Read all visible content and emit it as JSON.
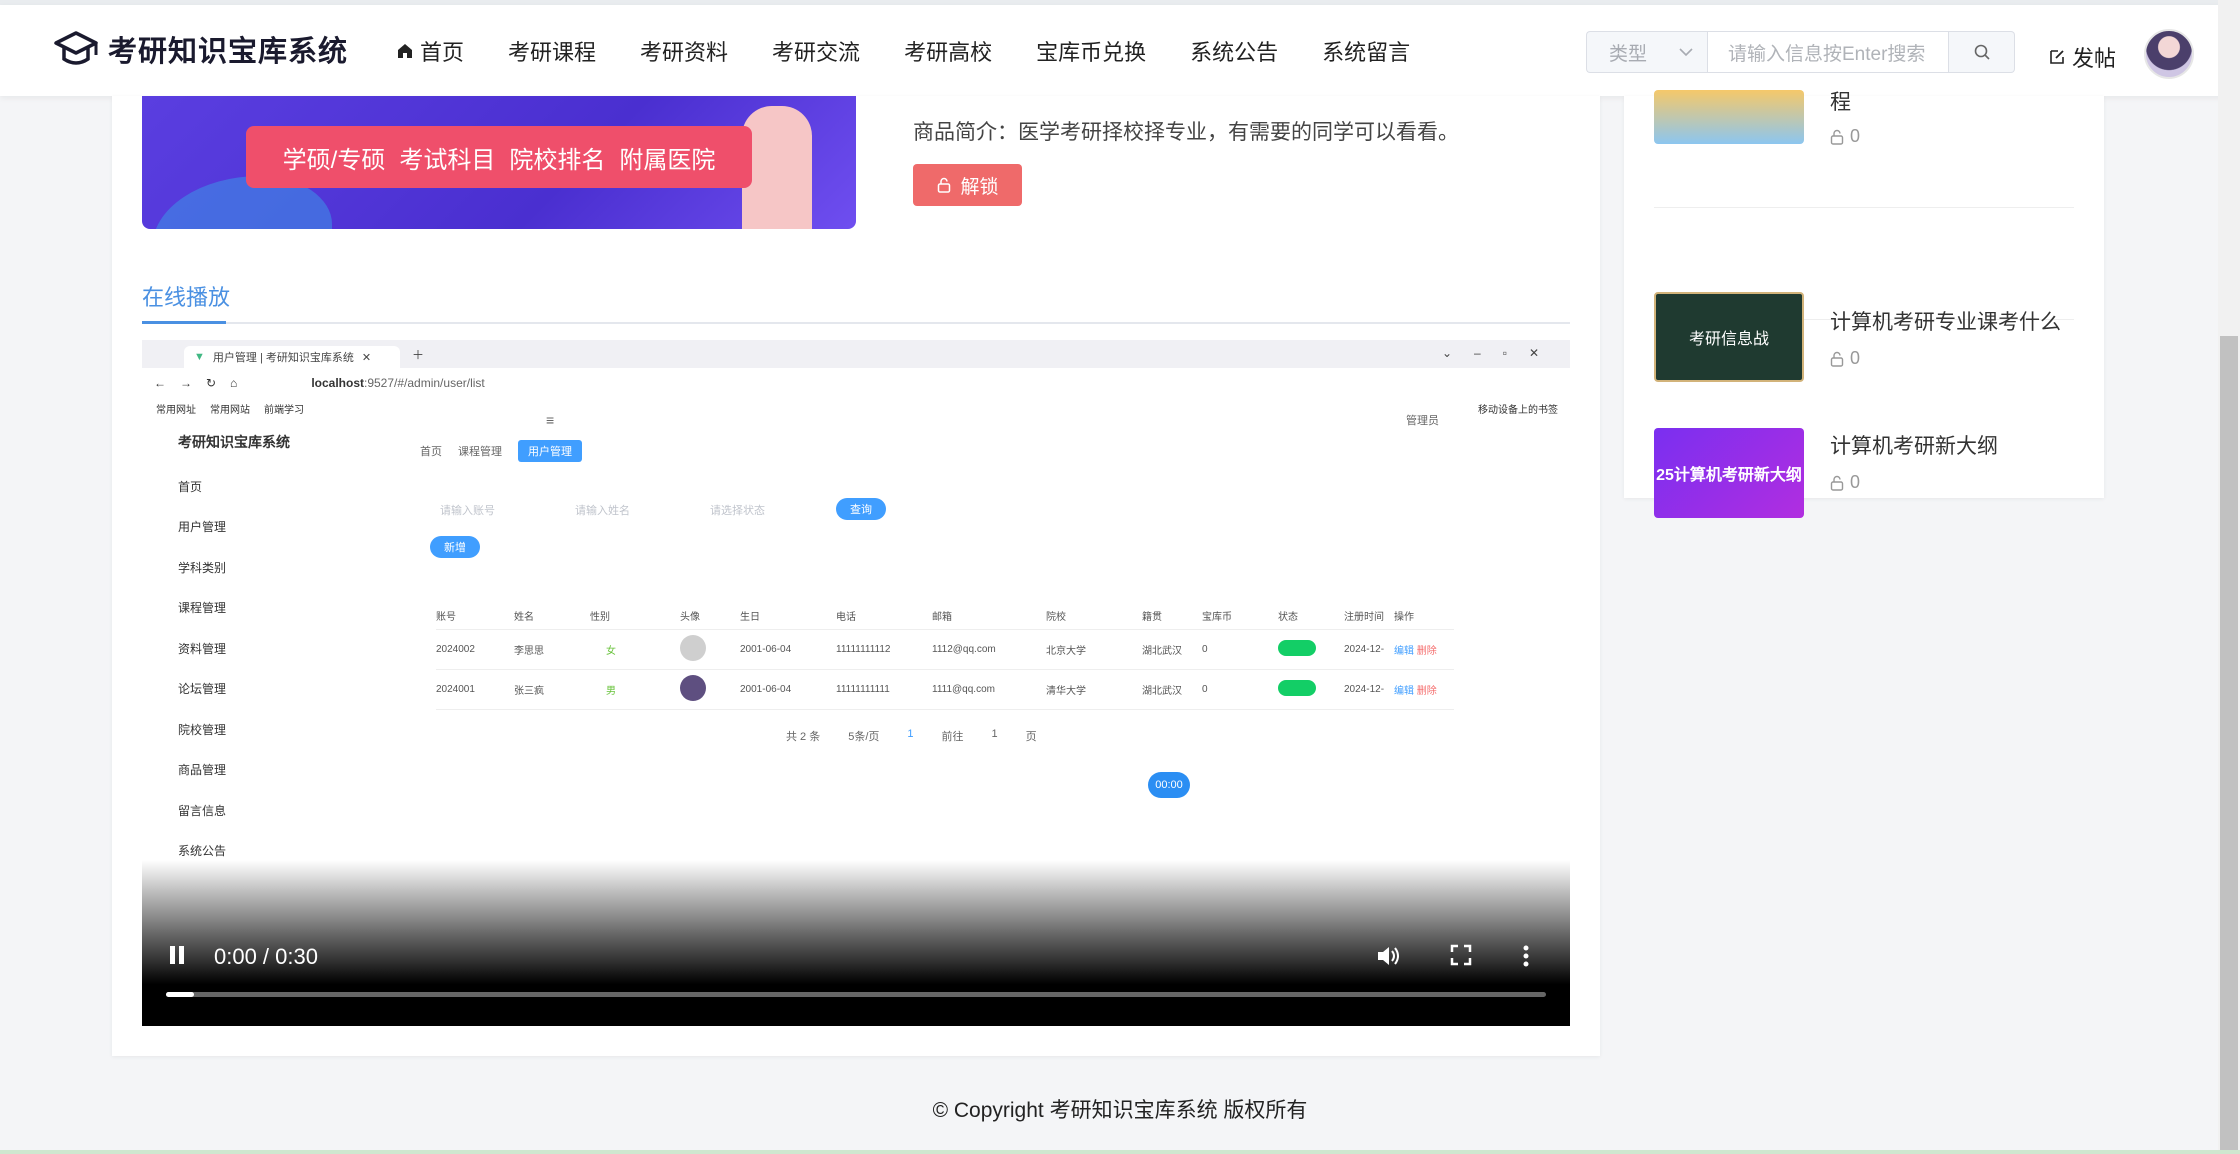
{
  "header": {
    "brand": "考研知识宝库系统",
    "nav": [
      "首页",
      "考研课程",
      "考研资料",
      "考研交流",
      "考研高校",
      "宝库币兑换",
      "系统公告",
      "系统留言"
    ],
    "search_type": "类型",
    "search_placeholder": "请输入信息按Enter搜索",
    "post_label": "发帖"
  },
  "detail": {
    "banner_tags": [
      "学硕/专硕",
      "考试科目",
      "院校排名",
      "附属医院"
    ],
    "intro": "商品简介：医学考研择校择专业，有需要的同学可以看看。",
    "unlock_label": "解锁"
  },
  "tab": {
    "label": "在线播放"
  },
  "video": {
    "browser_tab": "用户管理 | 考研知识宝库系统",
    "url_host": "localhost",
    "url_path": ":9527/#/admin/user/list",
    "bookmarks": [
      "常用网址",
      "常用网站",
      "前端学习"
    ],
    "mobile_bookmark": "移动设备上的书签",
    "app_brand": "考研知识宝库系统",
    "admin_label": "管理员",
    "menu": [
      "首页",
      "用户管理",
      "学科类别",
      "课程管理",
      "资料管理",
      "论坛管理",
      "院校管理",
      "商品管理",
      "留言信息",
      "系统公告"
    ],
    "breadcrumbs": [
      "首页",
      "课程管理",
      "用户管理"
    ],
    "filters": [
      "请输入账号",
      "请输入姓名",
      "请选择状态"
    ],
    "query_label": "查询",
    "add_label": "新增",
    "columns": [
      "账号",
      "姓名",
      "性别",
      "头像",
      "生日",
      "电话",
      "邮箱",
      "院校",
      "籍贯",
      "宝库币",
      "状态",
      "注册时间",
      "操作"
    ],
    "rows": [
      [
        "2024002",
        "李思思",
        "女",
        "",
        "2001-06-04",
        "11111111112",
        "1112@qq.com",
        "北京大学",
        "湖北武汉",
        "0",
        "",
        "2024-12-"
      ],
      [
        "2024001",
        "张三疯",
        "男",
        "",
        "2001-06-04",
        "11111111111",
        "1111@qq.com",
        "清华大学",
        "湖北武汉",
        "0",
        "",
        "2024-12-"
      ]
    ],
    "edit_label": "编辑",
    "delete_label": "删除",
    "pager": [
      "共 2 条",
      "5条/页",
      "1",
      "前往",
      "1",
      "页"
    ],
    "timer": "00:00",
    "time_display": "0:00 / 0:30",
    "progress": 0.02
  },
  "sidebar": {
    "items": [
      {
        "title": "程",
        "count": "0"
      },
      {
        "title": "计算机考研专业课考什么",
        "count": "0"
      },
      {
        "title": "计算机考研新大纲",
        "count": "0"
      }
    ],
    "thumb_texts": [
      "考研信息战",
      "25计算机考研新大纲"
    ]
  },
  "footer": {
    "text": "© Copyright 考研知识宝库系统 版权所有"
  },
  "colors": {
    "accent": "#4a90e2",
    "unlock": "#ef6a6a",
    "primary": "#409eff"
  }
}
